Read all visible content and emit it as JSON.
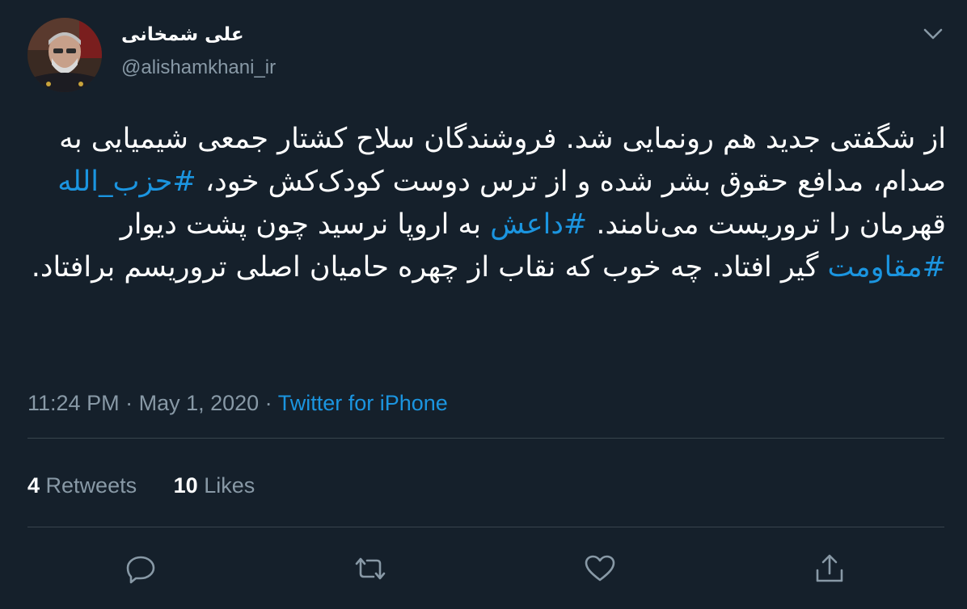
{
  "author": {
    "display_name": "علی شمخانی",
    "handle": "@alishamkhani_ir"
  },
  "tweet": {
    "segments": [
      {
        "text": "از شگفتی جدید هم رونمایی شد. فروشندگان سلاح کشتار جمعی شیمیایی به صدام، مدافع حقوق بشر شده و از ترس دوست کودک‌کش خود، ",
        "hashtag": false
      },
      {
        "text": "#حزب_الله",
        "hashtag": true
      },
      {
        "text": " قهرمان را تروریست می‌نامند. ",
        "hashtag": false
      },
      {
        "text": "#داعش",
        "hashtag": true
      },
      {
        "text": " به اروپا نرسید چون پشت دیوار ",
        "hashtag": false
      },
      {
        "text": "#مقاومت",
        "hashtag": true
      },
      {
        "text": " گیر افتاد. چه خوب که نقاب از چهره حامیان اصلی تروریسم برافتاد.",
        "hashtag": false
      }
    ]
  },
  "meta": {
    "time": "11:24 PM",
    "sep1": " · ",
    "date": "May 1, 2020",
    "sep2": " · ",
    "source": "Twitter for iPhone"
  },
  "stats": {
    "retweets_count": "4",
    "retweets_label": "Retweets",
    "likes_count": "10",
    "likes_label": "Likes"
  },
  "icons": {
    "more": "chevron-down-icon",
    "reply": "reply-icon",
    "retweet": "retweet-icon",
    "like": "heart-icon",
    "share": "share-icon"
  },
  "colors": {
    "background": "#15202b",
    "accent": "#1b95e0",
    "secondary_text": "#8899a6",
    "divider": "#38444d"
  }
}
